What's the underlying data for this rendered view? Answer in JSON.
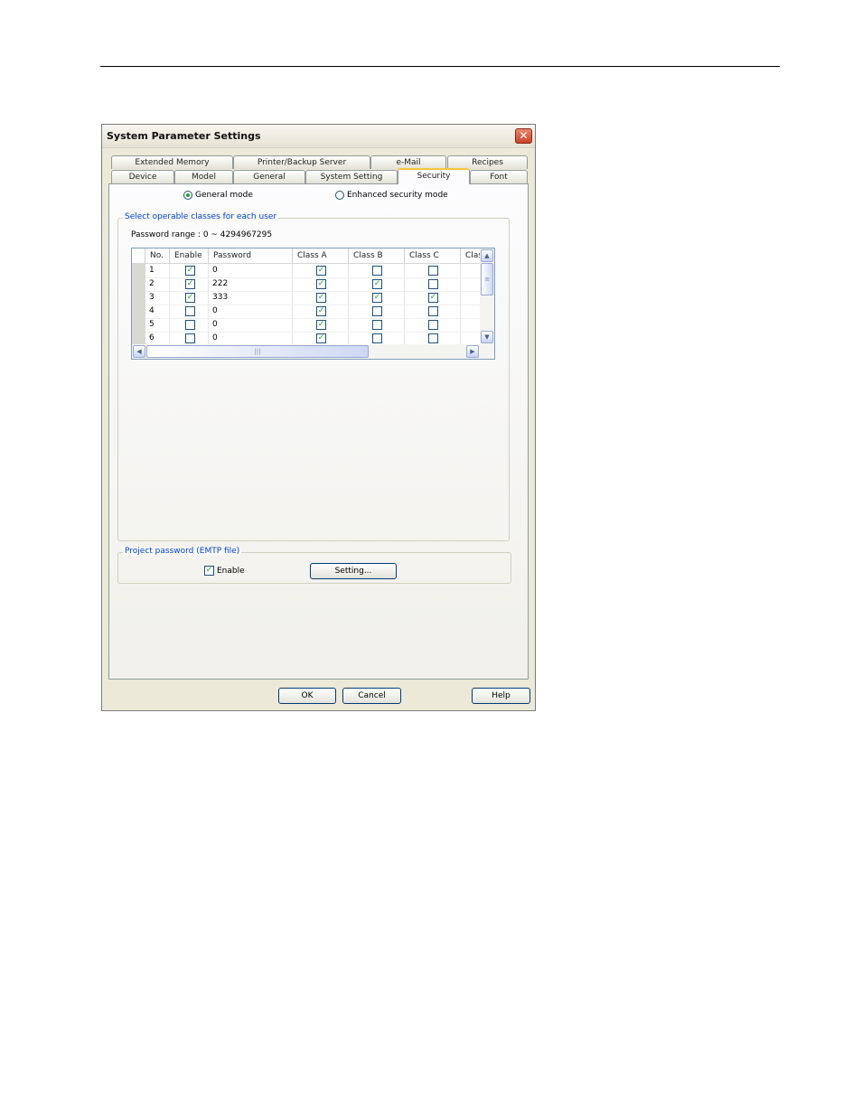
{
  "dialog": {
    "title": "System Parameter Settings",
    "close_glyph": "✕"
  },
  "tabs": {
    "row1": [
      "Extended Memory",
      "Printer/Backup Server",
      "e-Mail",
      "Recipes"
    ],
    "row2": [
      "Device",
      "Model",
      "General",
      "System Setting",
      "Security",
      "Font"
    ],
    "active": "Security"
  },
  "mode": {
    "general_label": "General mode",
    "enhanced_label": "Enhanced security mode",
    "selected": "general"
  },
  "classes_group": {
    "label": "Select operable classes for each user",
    "password_range": "Password range : 0 ~ 4294967295"
  },
  "table": {
    "headers": [
      "No.",
      "Enable",
      "Password",
      "Class A",
      "Class B",
      "Class C",
      "Clas"
    ],
    "rows": [
      {
        "no": "1",
        "enable": true,
        "password": "0",
        "a": true,
        "b": false,
        "c": false
      },
      {
        "no": "2",
        "enable": true,
        "password": "222",
        "a": true,
        "b": true,
        "c": false
      },
      {
        "no": "3",
        "enable": true,
        "password": "333",
        "a": true,
        "b": true,
        "c": true
      },
      {
        "no": "4",
        "enable": false,
        "password": "0",
        "a": true,
        "b": false,
        "c": false
      },
      {
        "no": "5",
        "enable": false,
        "password": "0",
        "a": true,
        "b": false,
        "c": false
      },
      {
        "no": "6",
        "enable": false,
        "password": "0",
        "a": true,
        "b": false,
        "c": false
      }
    ]
  },
  "project_group": {
    "label": "Project password (EMTP file)",
    "enable_label": "Enable",
    "enable_checked": true,
    "setting_label": "Setting..."
  },
  "buttons": {
    "ok": "OK",
    "cancel": "Cancel",
    "help": "Help"
  },
  "icons": {
    "close": "close-icon",
    "check": "check-icon",
    "scroll_up": "scroll-up-arrow-icon",
    "scroll_down": "scroll-down-arrow-icon",
    "scroll_left": "scroll-left-arrow-icon",
    "scroll_right": "scroll-right-arrow-icon"
  },
  "colors": {
    "accent_tab": "#ffc83c",
    "check_green": "#21a121",
    "group_label_blue": "#0046d5",
    "close_red": "#c9432a"
  }
}
